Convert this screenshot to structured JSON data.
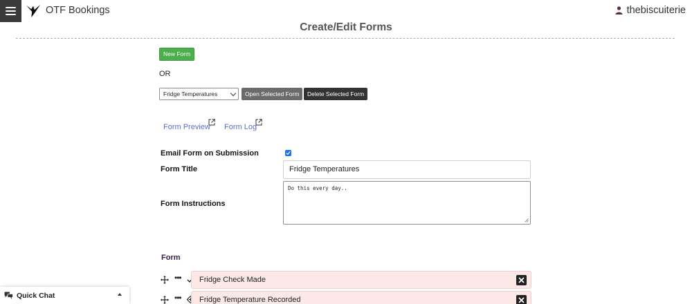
{
  "app": {
    "title": "OTF Bookings"
  },
  "user": {
    "name": "thebiscuiterie"
  },
  "page": {
    "title": "Create/Edit Forms"
  },
  "actions": {
    "new_form": "New Form",
    "or": "OR",
    "selected_form": "Fridge Temperatures",
    "open_selected": "Open Selected Form",
    "delete_selected": "Delete Selected Form"
  },
  "links": {
    "preview": "Form Preview",
    "log": "Form Log"
  },
  "settings": {
    "email_label": "Email Form on Submission",
    "email_checked": true,
    "title_label": "Form Title",
    "title_value": "Fridge Temperatures",
    "instructions_label": "Form Instructions",
    "instructions_value": "Do this every day.."
  },
  "form_section": {
    "label": "Form"
  },
  "fields": [
    {
      "name": "Fridge Check Made",
      "type_icon": "checkmark-icon"
    },
    {
      "name": "Fridge Temperature Recorded",
      "type_icon": "tag-icon"
    }
  ],
  "quick_chat": {
    "label": "Quick Chat"
  },
  "colors": {
    "green_button": "#4cae4c",
    "field_row_bg": "#fde8e8",
    "link": "#5a6ec8",
    "user_icon": "#5b2a4e"
  }
}
